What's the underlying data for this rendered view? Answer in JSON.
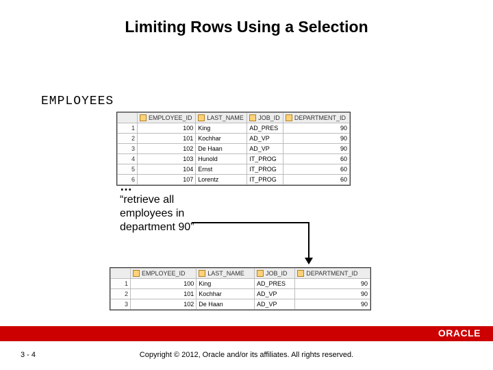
{
  "title": "Limiting Rows Using a Selection",
  "table_label": "EMPLOYEES",
  "ellipsis": "…",
  "quote_line1": "“retrieve all",
  "quote_line2": "employees in",
  "quote_line3": "department 90”",
  "headers": [
    "EMPLOYEE_ID",
    "LAST_NAME",
    "JOB_ID",
    "DEPARTMENT_ID"
  ],
  "top_rows": [
    {
      "n": 1,
      "employee_id": "100",
      "last_name": "King",
      "job_id": "AD_PRES",
      "department_id": "90"
    },
    {
      "n": 2,
      "employee_id": "101",
      "last_name": "Kochhar",
      "job_id": "AD_VP",
      "department_id": "90"
    },
    {
      "n": 3,
      "employee_id": "102",
      "last_name": "De Haan",
      "job_id": "AD_VP",
      "department_id": "90"
    },
    {
      "n": 4,
      "employee_id": "103",
      "last_name": "Hunold",
      "job_id": "IT_PROG",
      "department_id": "60"
    },
    {
      "n": 5,
      "employee_id": "104",
      "last_name": "Ernst",
      "job_id": "IT_PROG",
      "department_id": "60"
    },
    {
      "n": 6,
      "employee_id": "107",
      "last_name": "Lorentz",
      "job_id": "IT_PROG",
      "department_id": "60"
    }
  ],
  "bottom_rows": [
    {
      "n": 1,
      "employee_id": "100",
      "last_name": "King",
      "job_id": "AD_PRES",
      "department_id": "90"
    },
    {
      "n": 2,
      "employee_id": "101",
      "last_name": "Kochhar",
      "job_id": "AD_VP",
      "department_id": "90"
    },
    {
      "n": 3,
      "employee_id": "102",
      "last_name": "De Haan",
      "job_id": "AD_VP",
      "department_id": "90"
    }
  ],
  "logo_text": "ORACLE",
  "page_number": "3 - 4",
  "copyright": "Copyright © 2012, Oracle and/or its affiliates. All rights reserved."
}
